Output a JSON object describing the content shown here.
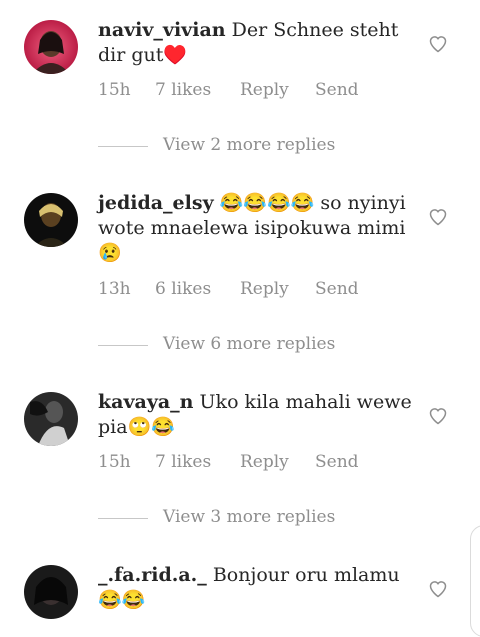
{
  "comments": [
    {
      "username": "naviv_vivian",
      "text": "Der Schnee steht dir gut♥️",
      "time": "15h",
      "likes": "7 likes",
      "reply": "Reply",
      "send": "Send",
      "more_replies": "View 2 more replies"
    },
    {
      "username": "jedida_elsy",
      "text": "😂😂😂😂 so nyinyi wote mnaelewa isipokuwa mimi😢",
      "time": "13h",
      "likes": "6 likes",
      "reply": "Reply",
      "send": "Send",
      "more_replies": "View 6 more replies"
    },
    {
      "username": "kavaya_n",
      "text": "Uko kila mahali wewe pia🙄😂",
      "time": "15h",
      "likes": "7 likes",
      "reply": "Reply",
      "send": "Send",
      "more_replies": "View 3 more replies"
    },
    {
      "username": "_.fa.rid.a._",
      "text": "Bonjour oru mlamu 😂😂"
    }
  ],
  "colors": {
    "text": "#262626",
    "secondary": "#8e8e8e",
    "divider": "#c7c7c7"
  },
  "icons": {
    "like": "heart-outline-icon"
  }
}
